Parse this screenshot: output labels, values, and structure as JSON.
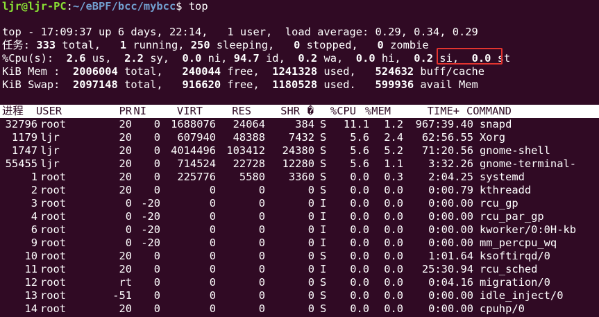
{
  "prompt": {
    "user_host": "ljr@ljr-PC",
    "sep": ":",
    "path": "~/eBPF/bcc/mybcc",
    "dollar": "$",
    "command": "top"
  },
  "summary": {
    "uptime_label": "top - ",
    "time": "17:09:37",
    "up_label": " up ",
    "uptime": "6 days, 22:14,",
    "users": "1",
    "users_label": " user,",
    "load_label": "  load average: ",
    "load": "0.29, 0.34, 0.29",
    "tasks_label": "任务:",
    "tasks_total": "333",
    "tasks_running": "1",
    "tasks_sleeping": "250",
    "tasks_stopped": "0",
    "tasks_zombie": "0",
    "cpu_label": "%Cpu(s):",
    "cpu_us": "2.6",
    "cpu_sy": "2.2",
    "cpu_ni": "0.0",
    "cpu_id": "94.7",
    "cpu_wa": "0.2",
    "cpu_hi": "0.0",
    "cpu_si": "0.2",
    "cpu_st": "0.0",
    "mem_label": "KiB Mem :",
    "mem_total": "2006004",
    "mem_free": "240044",
    "mem_used": "1241328",
    "mem_buff": "524632",
    "swap_label": "KiB Swap:",
    "swap_total": "2097148",
    "swap_free": "916620",
    "swap_used": "1180528",
    "swap_avail": "599936"
  },
  "columns": [
    "进程",
    "USER",
    "PR",
    "NI",
    "VIRT",
    "RES",
    "SHR",
    "�",
    "%CPU",
    "%MEM",
    "TIME+",
    "COMMAND"
  ],
  "processes": [
    [
      "32796",
      "root",
      "20",
      "0",
      "1688076",
      "24064",
      "384",
      "S",
      "11.1",
      "1.2",
      "967:39.40",
      "snapd"
    ],
    [
      "1179",
      "ljr",
      "20",
      "0",
      "607940",
      "48388",
      "7432",
      "S",
      "5.6",
      "2.4",
      "62:56.55",
      "Xorg"
    ],
    [
      "1747",
      "ljr",
      "20",
      "0",
      "4014496",
      "103412",
      "24380",
      "S",
      "5.6",
      "5.2",
      "71:20.56",
      "gnome-shell"
    ],
    [
      "55455",
      "ljr",
      "20",
      "0",
      "714524",
      "22728",
      "12280",
      "S",
      "5.6",
      "1.1",
      "3:32.26",
      "gnome-terminal-"
    ],
    [
      "1",
      "root",
      "20",
      "0",
      "225776",
      "5580",
      "3360",
      "S",
      "0.0",
      "0.3",
      "2:04.25",
      "systemd"
    ],
    [
      "2",
      "root",
      "20",
      "0",
      "0",
      "0",
      "0",
      "S",
      "0.0",
      "0.0",
      "0:00.79",
      "kthreadd"
    ],
    [
      "3",
      "root",
      "0",
      "-20",
      "0",
      "0",
      "0",
      "I",
      "0.0",
      "0.0",
      "0:00.00",
      "rcu_gp"
    ],
    [
      "4",
      "root",
      "0",
      "-20",
      "0",
      "0",
      "0",
      "I",
      "0.0",
      "0.0",
      "0:00.00",
      "rcu_par_gp"
    ],
    [
      "6",
      "root",
      "0",
      "-20",
      "0",
      "0",
      "0",
      "I",
      "0.0",
      "0.0",
      "0:00.00",
      "kworker/0:0H-kb"
    ],
    [
      "9",
      "root",
      "0",
      "-20",
      "0",
      "0",
      "0",
      "I",
      "0.0",
      "0.0",
      "0:00.00",
      "mm_percpu_wq"
    ],
    [
      "10",
      "root",
      "20",
      "0",
      "0",
      "0",
      "0",
      "S",
      "0.0",
      "0.0",
      "1:01.64",
      "ksoftirqd/0"
    ],
    [
      "11",
      "root",
      "20",
      "0",
      "0",
      "0",
      "0",
      "I",
      "0.0",
      "0.0",
      "25:30.94",
      "rcu_sched"
    ],
    [
      "12",
      "root",
      "rt",
      "0",
      "0",
      "0",
      "0",
      "S",
      "0.0",
      "0.0",
      "0:04.16",
      "migration/0"
    ],
    [
      "13",
      "root",
      "-51",
      "0",
      "0",
      "0",
      "0",
      "S",
      "0.0",
      "0.0",
      "0:00.00",
      "idle_inject/0"
    ],
    [
      "14",
      "root",
      "20",
      "0",
      "0",
      "0",
      "0",
      "S",
      "0.0",
      "0.0",
      "0:00.00",
      "cpuhp/0"
    ]
  ],
  "highlight_note": "si"
}
